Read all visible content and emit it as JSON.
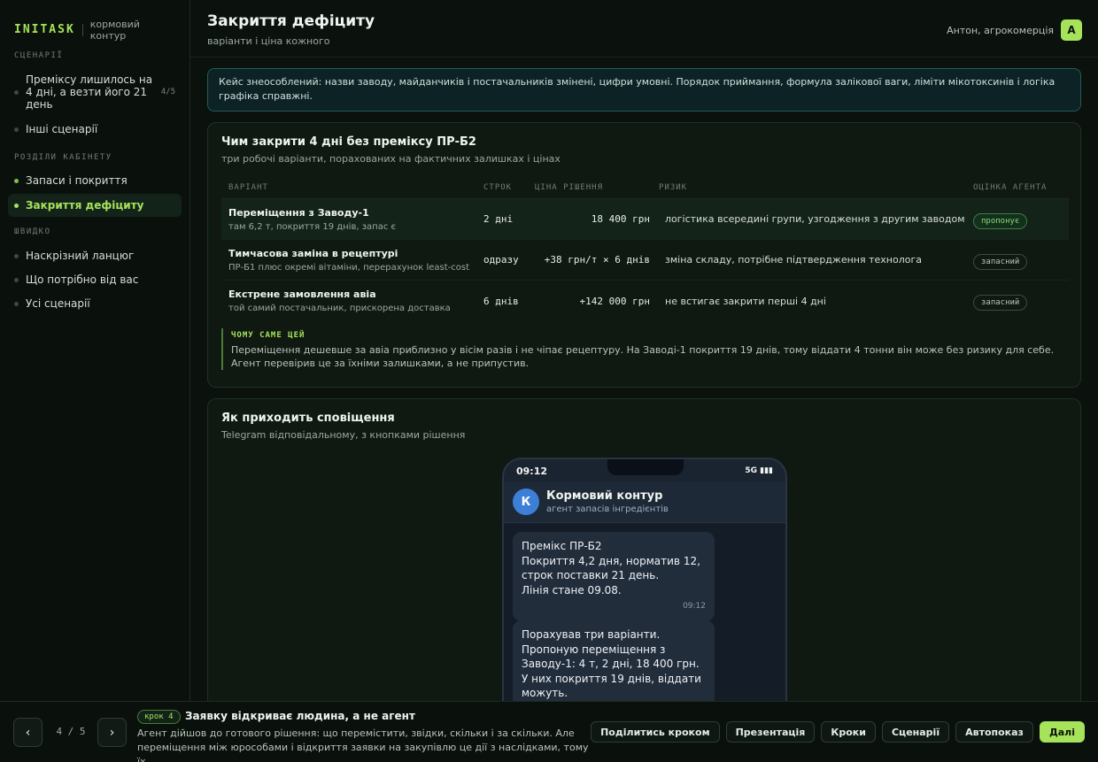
{
  "brand": {
    "logo": "INITASK",
    "subtitle": "кормовий контур"
  },
  "sidebar": {
    "sections": [
      {
        "title": "СЦЕНАРІЇ",
        "items": [
          {
            "label": "Преміксу лишилось на 4 дні, а везти його 21 день",
            "count": "4/5"
          },
          {
            "label": "Інші сценарії"
          }
        ]
      },
      {
        "title": "РОЗДІЛИ КАБІНЕТУ",
        "items": [
          {
            "label": "Запаси і покриття"
          },
          {
            "label": "Закриття дефіциту",
            "active": true
          }
        ]
      },
      {
        "title": "ШВИДКО",
        "items": [
          {
            "label": "Наскрізний ланцюг"
          },
          {
            "label": "Що потрібно від вас"
          },
          {
            "label": "Усі сценарії"
          }
        ]
      }
    ]
  },
  "header": {
    "title": "Закриття дефіциту",
    "subtitle": "варіанти і ціна кожного",
    "user_name": "Антон, агрокомерція",
    "avatar": "А"
  },
  "notice": "Кейс знеособлений: назви заводу, майданчиків і постачальників змінені, цифри умовні. Порядок приймання, формула залікової ваги, ліміти мікотоксинів і логіка графіка справжні.",
  "options_card": {
    "title": "Чим закрити 4 дні без преміксу ПР-Б2",
    "subtitle": "три робочі варіанти, порахованих на фактичних залишках і цінах",
    "columns": [
      "ВАРІАНТ",
      "СТРОК",
      "ЦІНА РІШЕННЯ",
      "РИЗИК",
      "ОЦІНКА АГЕНТА"
    ],
    "rows": [
      {
        "name": "Переміщення з Заводу-1",
        "detail": "там 6,2 т, покриття 19 днів, запас є",
        "term": "2 дні",
        "price": "18 400 грн",
        "risk": "логістика всередині групи, узгодження з другим заводом",
        "rating": "пропонує"
      },
      {
        "name": "Тимчасова заміна в рецептурі",
        "detail": "ПР-Б1 плюс окремі вітаміни, перерахунок least-cost",
        "term": "одразу",
        "price": "+38 грн/т × 6 днів",
        "risk": "зміна складу, потрібне підтвердження технолога",
        "rating": "запасний"
      },
      {
        "name": "Екстрене замовлення авіа",
        "detail": "той самий постачальник, прискорена доставка",
        "term": "6 днів",
        "price": "+142 000 грн",
        "risk": "не встигає закрити перші 4 дні",
        "rating": "запасний"
      }
    ],
    "why_title": "ЧОМУ САМЕ ЦЕЙ",
    "why_text": "Переміщення дешевше за авіа приблизно у вісім разів і не чіпає рецептуру. На Заводі-1 покриття 19 днів, тому віддати 4 тонни він може без ризику для себе. Агент перевірив це за їхніми залишками, а не припустив."
  },
  "notify_card": {
    "title": "Як приходить сповіщення",
    "subtitle": "Telegram відповідальному, з кнопками рішення",
    "phone": {
      "time": "09:12",
      "signal": "5G ▮▮▮",
      "chat_avatar": "К",
      "chat_name": "Кормовий контур",
      "chat_desc": "агент запасів інгредієнтів",
      "messages": [
        {
          "text": "Премікс ПР-Б2\nПокриття 4,2 дня, норматив 12, строк поставки 21 день.\nЛінія стане 09.08.",
          "time": "09:12"
        },
        {
          "text": "Порахував три варіанти.\nПропоную переміщення з Заводу-1: 4 т, 2 дні, 18 400 грн.\nУ них покриття 19 днів, віддати можуть."
        }
      ]
    }
  },
  "bottombar": {
    "pager": "4 / 5",
    "step_badge": "крок 4",
    "step_title": "Заявку відкриває людина, а не агент",
    "step_desc": "Агент дійшов до готового рішення: що перемістити, звідки, скільки і за скільки. Але переміщення між юрособами і відкриття заявки на закупівлю це дії з наслідками, тому їх...",
    "buttons": [
      "Поділитись кроком",
      "Презентація",
      "Кроки",
      "Сценарії",
      "Автопоказ",
      "Далі"
    ]
  }
}
